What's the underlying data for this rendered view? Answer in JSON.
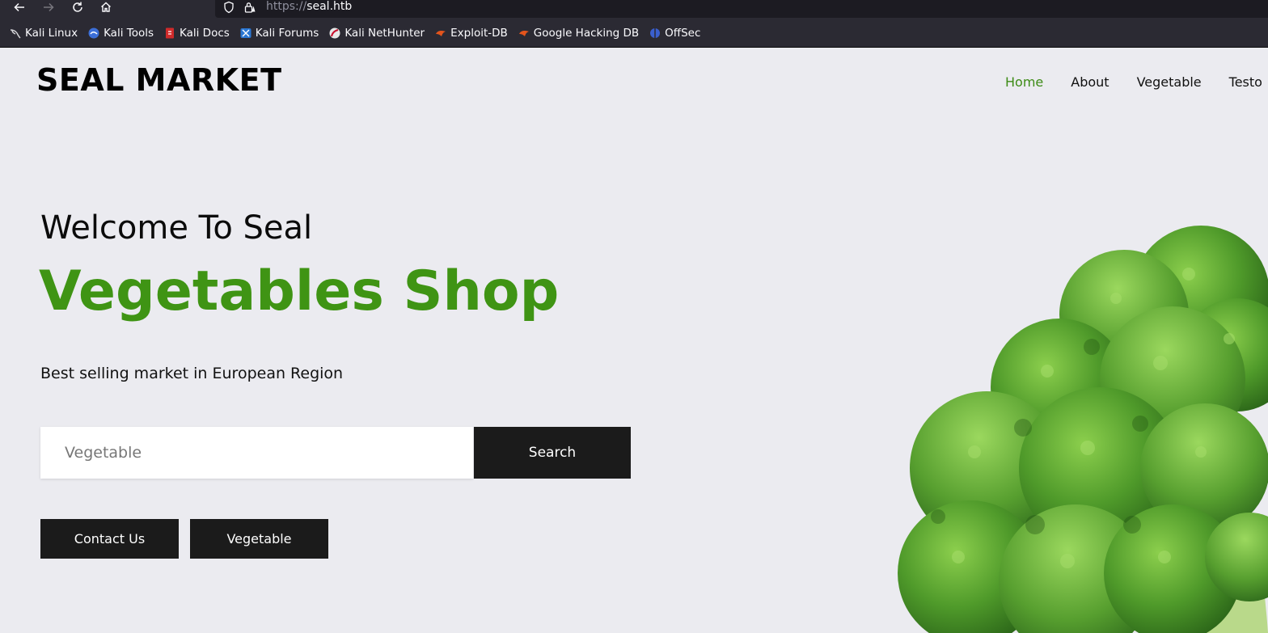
{
  "browser": {
    "url_protocol": "https://",
    "url_host": "seal.htb",
    "bookmarks": [
      {
        "label": "Kali Linux",
        "icon": "kali-dragon-icon"
      },
      {
        "label": "Kali Tools",
        "icon": "kali-tools-icon"
      },
      {
        "label": "Kali Docs",
        "icon": "kali-docs-icon"
      },
      {
        "label": "Kali Forums",
        "icon": "kali-forums-icon"
      },
      {
        "label": "Kali NetHunter",
        "icon": "nethunter-icon"
      },
      {
        "label": "Exploit-DB",
        "icon": "exploit-db-icon"
      },
      {
        "label": "Google Hacking DB",
        "icon": "ghdb-icon"
      },
      {
        "label": "OffSec",
        "icon": "offsec-icon"
      }
    ]
  },
  "site": {
    "brand": "SEAL MARKET",
    "nav": [
      {
        "label": "Home",
        "active": true
      },
      {
        "label": "About",
        "active": false
      },
      {
        "label": "Vegetable",
        "active": false
      },
      {
        "label": "Testo",
        "active": false
      }
    ]
  },
  "hero": {
    "subtitle": "Welcome To Seal",
    "title": "Vegetables Shop",
    "tagline": "Best selling market in European Region",
    "search_placeholder": "Vegetable",
    "search_button": "Search",
    "contact_button": "Contact Us",
    "vegetable_button": "Vegetable"
  },
  "colors": {
    "accent": "#3f9414",
    "nav_active": "#3d8b16",
    "button_bg": "#1b1b1b",
    "page_bg": "#ebebf0",
    "chrome_bg": "#2b2a33"
  }
}
